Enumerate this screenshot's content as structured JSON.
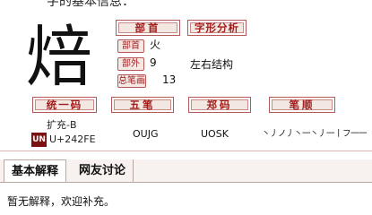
{
  "page": {
    "top_title": "字的基本信息："
  },
  "character": {
    "glyph": "焙"
  },
  "headers": {
    "radical_section": "部首",
    "structure_section": "字形分析",
    "unicode_section": "统一码",
    "wubi_section": "五笔",
    "zhengma_section": "郑码",
    "stroke_order_section": "笔顺"
  },
  "info": {
    "radical_label": "部首",
    "radical_value": "火",
    "outside_label": "部外",
    "outside_value": "9",
    "total_label": "总笔画",
    "total_value": "13",
    "structure_value": "左右结构"
  },
  "codes": {
    "unicode_block": "扩充-B",
    "unicode_value": "U+242FE",
    "unicode_logo": "UN",
    "wubi_value": "OUJG",
    "zhengma_value": "UOSK",
    "stroke_order_value": "丶丿ノ丿丶一丶丿一丨フ一一"
  },
  "tabs": [
    {
      "label": "基本解释"
    },
    {
      "label": "网友讨论"
    }
  ],
  "content": {
    "body_text": "暂无解释，欢迎补充。"
  },
  "colors": {
    "accent_red": "#a21d1d",
    "header_bg": "#f3e7e2",
    "border": "#b45858"
  }
}
